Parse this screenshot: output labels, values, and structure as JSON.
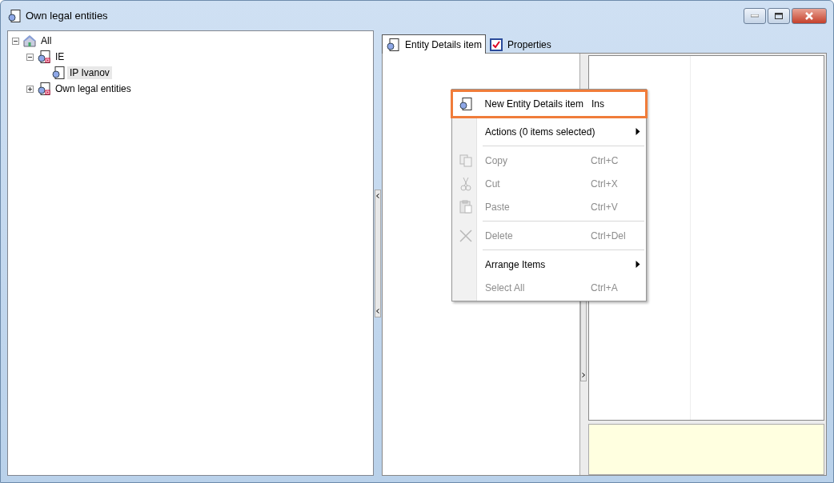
{
  "window": {
    "title": "Own legal entities"
  },
  "tree": [
    {
      "label": "All",
      "kind": "root",
      "expanded": true,
      "selected": false,
      "children": [
        {
          "label": "IE",
          "kind": "group",
          "expanded": true,
          "selected": false,
          "children": [
            {
              "label": "IP Ivanov",
              "kind": "entity",
              "selected": true
            }
          ]
        },
        {
          "label": "Own legal entities",
          "kind": "group",
          "expanded": false,
          "selected": false
        }
      ]
    }
  ],
  "tabs": [
    {
      "label": "Entity Details item",
      "selected": true
    },
    {
      "label": "Properties",
      "selected": false
    }
  ],
  "context_menu": [
    {
      "kind": "item",
      "label": "New Entity Details item",
      "shortcut": "Ins",
      "selected": true,
      "disabled": false,
      "submenu": false
    },
    {
      "kind": "item",
      "label": "Actions (0 items selected)",
      "selected": false,
      "disabled": false,
      "submenu": true
    },
    {
      "kind": "separator"
    },
    {
      "kind": "item",
      "label": "Copy",
      "shortcut": "Ctrl+C",
      "selected": false,
      "disabled": true,
      "submenu": false
    },
    {
      "kind": "item",
      "label": "Cut",
      "shortcut": "Ctrl+X",
      "selected": false,
      "disabled": true,
      "submenu": false
    },
    {
      "kind": "item",
      "label": "Paste",
      "shortcut": "Ctrl+V",
      "selected": false,
      "disabled": true,
      "submenu": false
    },
    {
      "kind": "separator"
    },
    {
      "kind": "item",
      "label": "Delete",
      "shortcut": "Ctrl+Del",
      "selected": false,
      "disabled": true,
      "submenu": false
    },
    {
      "kind": "separator"
    },
    {
      "kind": "item",
      "label": "Arrange Items",
      "selected": false,
      "disabled": false,
      "submenu": true
    },
    {
      "kind": "item",
      "label": "Select All",
      "shortcut": "Ctrl+A",
      "selected": false,
      "disabled": true,
      "submenu": false
    }
  ]
}
